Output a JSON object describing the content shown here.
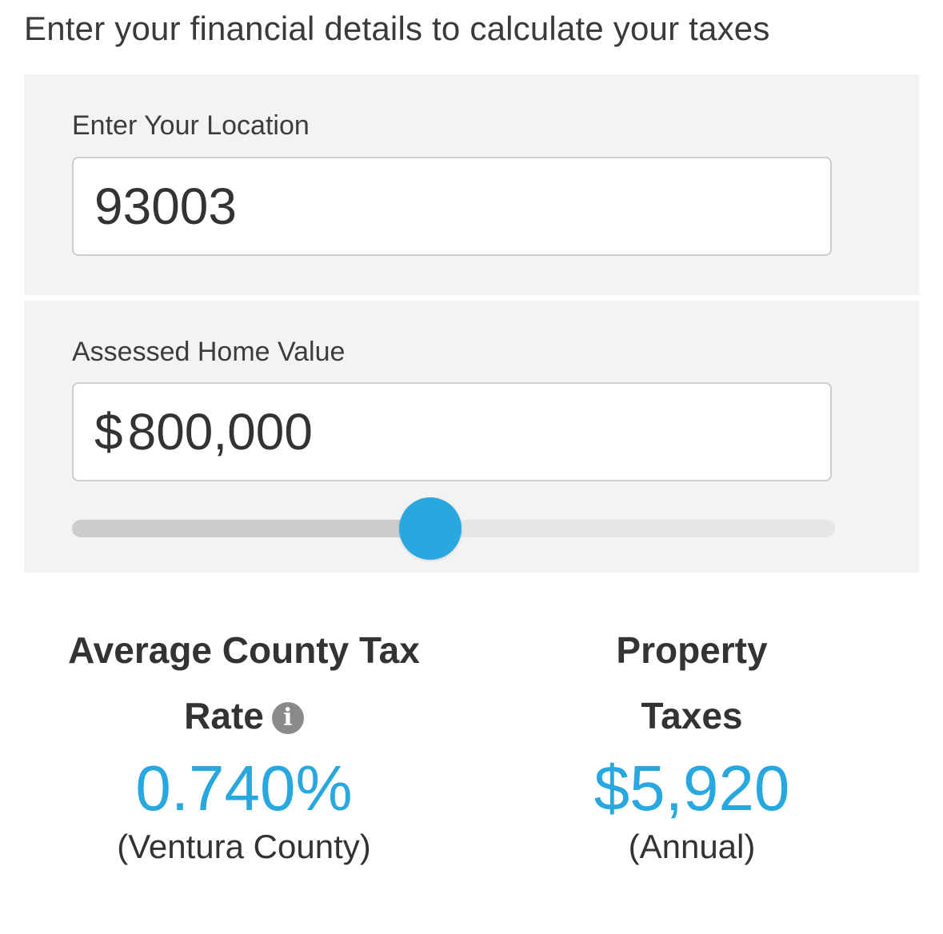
{
  "intro_text": "Enter your financial details to calculate your taxes",
  "location": {
    "label": "Enter Your Location",
    "value": "93003"
  },
  "home_value": {
    "label": "Assessed Home Value",
    "currency_symbol": "$",
    "value": "800,000",
    "slider_position": 0.47
  },
  "results": {
    "rate": {
      "title_line1": "Average County Tax",
      "title_line2": "Rate",
      "info_icon": "info-icon",
      "value": "0.740%",
      "note": "(Ventura County)"
    },
    "taxes": {
      "title_line1": "Property",
      "title_line2": "Taxes",
      "value": "$5,920",
      "note": "(Annual)"
    }
  },
  "colors": {
    "accent": "#29a8e0",
    "panel_background": "#f3f3f4"
  }
}
